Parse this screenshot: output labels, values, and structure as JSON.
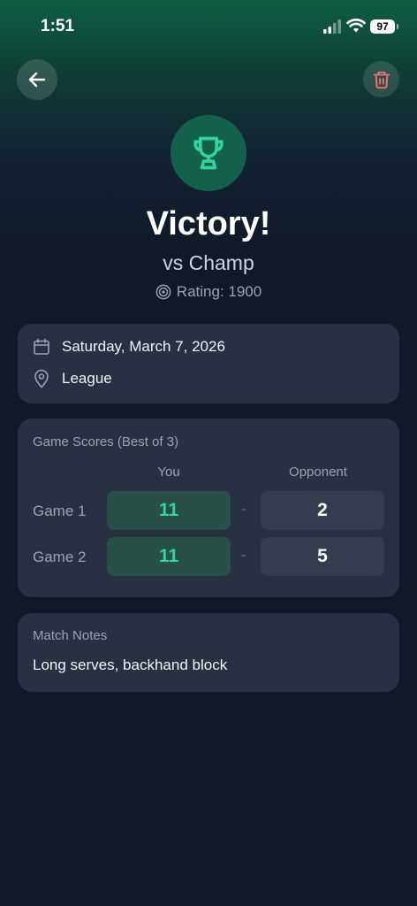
{
  "status_bar": {
    "time": "1:51",
    "battery": "97"
  },
  "header": {
    "back_icon": "arrow-left-icon",
    "delete_icon": "trash-icon"
  },
  "result": {
    "title": "Victory!",
    "opponent": "vs Champ",
    "rating": "Rating: 1900"
  },
  "info": {
    "date": "Saturday, March 7, 2026",
    "match_type": "League"
  },
  "scores": {
    "section_title": "Game Scores (Best of 3)",
    "col_you": "You",
    "col_opponent": "Opponent",
    "separator": "-",
    "games": [
      {
        "label": "Game 1",
        "you": "11",
        "opponent": "2"
      },
      {
        "label": "Game 2",
        "you": "11",
        "opponent": "5"
      }
    ]
  },
  "notes": {
    "section_title": "Match Notes",
    "text": "Long serves, backhand block"
  },
  "colors": {
    "accent_green": "#34d399",
    "delete_red": "#f87171",
    "card_bg": "#283042",
    "page_bg": "#111827"
  }
}
